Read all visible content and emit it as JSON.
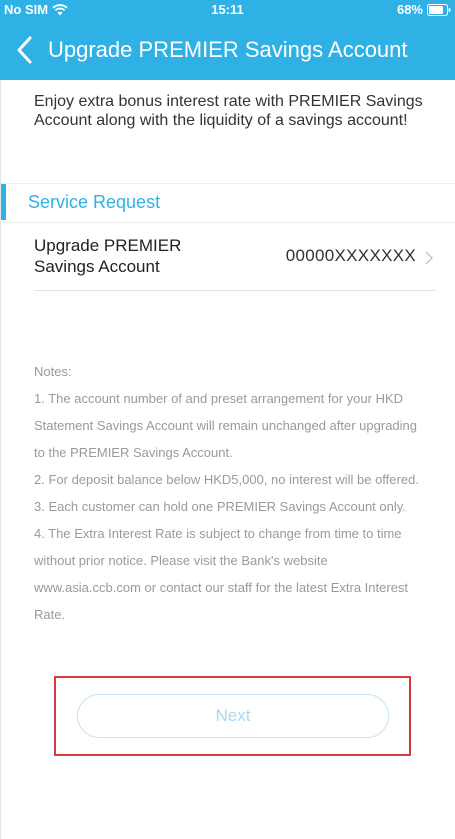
{
  "status_bar": {
    "carrier": "No SIM",
    "time": "15:11",
    "battery": "68%"
  },
  "header": {
    "title": "Upgrade PREMIER Savings Account"
  },
  "intro": "Enjoy extra bonus interest rate with PREMIER Savings Account along with the liquidity of a savings account!",
  "section": {
    "title": "Service Request"
  },
  "account_row": {
    "label": "Upgrade PREMIER Savings Account",
    "value": "00000XXXXXXX"
  },
  "notes": {
    "heading": "Notes:",
    "items": [
      "1.  The account number of and preset arrangement for your HKD Statement Savings Account will remain unchanged after upgrading to the PREMIER Savings Account.",
      "2.  For deposit balance below HKD5,000, no interest will be offered.",
      "3.  Each customer can hold one PREMIER Savings Account only.",
      "4.  The Extra Interest Rate is subject to change from time to time without prior notice. Please visit the Bank's website www.asia.ccb.com or contact our staff for the latest Extra Interest Rate."
    ]
  },
  "next_button": {
    "label": "Next"
  },
  "colors": {
    "accent": "#2fb1e6",
    "highlight": "#d9393a",
    "notes_text": "#9a9a9a"
  },
  "icons": {
    "wifi": "wifi-icon",
    "battery": "battery-icon",
    "back": "back-chevron-icon",
    "row": "chevron-right-icon"
  }
}
